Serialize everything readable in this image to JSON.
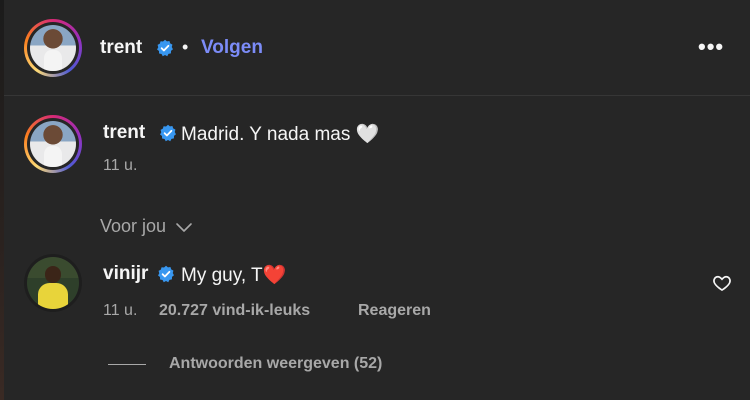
{
  "header": {
    "username": "trent",
    "separator": "•",
    "follow_label": "Volgen",
    "more_label": "•••"
  },
  "post": {
    "username": "trent",
    "caption": "Madrid. Y nada mas 🤍",
    "time": "11 u."
  },
  "section": {
    "label": "Voor jou"
  },
  "comment": {
    "username": "vinijr",
    "text": "My guy, T❤️",
    "time": "11 u.",
    "likes": "20.727 vind-ik-leuks",
    "reply_label": "Reageren",
    "view_replies": "Antwoorden weergeven (52)"
  },
  "colors": {
    "background": "#262626",
    "accent": "#7c8cf8",
    "verified": "#3897f0",
    "muted": "#a8a8a8"
  },
  "icons": [
    "verified-badge-icon",
    "chevron-down-icon",
    "heart-outline-icon",
    "more-options-icon"
  ]
}
